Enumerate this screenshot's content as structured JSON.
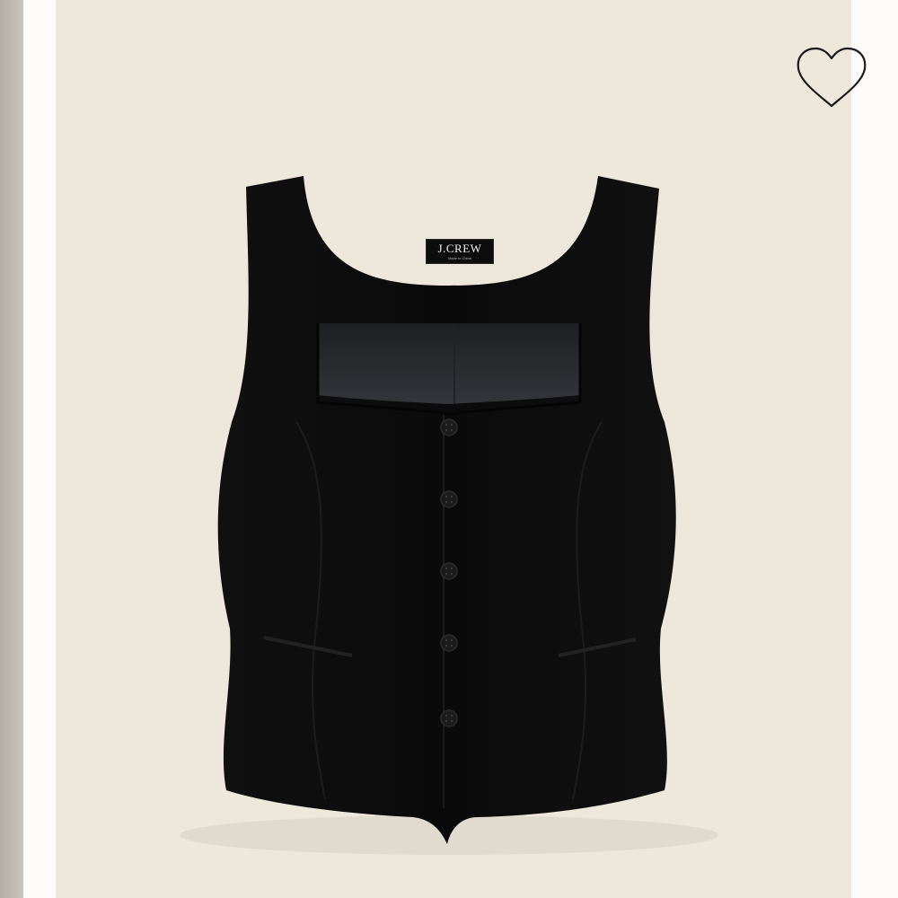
{
  "product_image": {
    "alt": "J.Crew black square-neck vest",
    "label": {
      "brand": "J.CREW",
      "subtext": "Made in China"
    },
    "buttons_count": 5
  },
  "favorite": {
    "icon": "heart-icon",
    "state": "not-favorited"
  },
  "colors": {
    "background": "#ede7dc",
    "garment": "#0d0d0d",
    "lining": "#2a2b2e"
  }
}
